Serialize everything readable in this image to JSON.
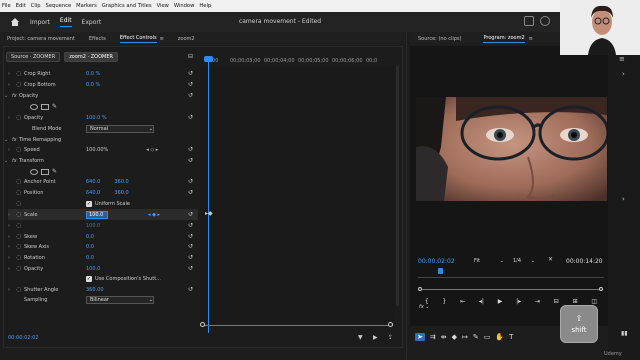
{
  "menu": [
    "File",
    "Edit",
    "Clip",
    "Sequence",
    "Markers",
    "Graphics and Titles",
    "View",
    "Window",
    "Help"
  ],
  "appbar": {
    "tabs": [
      "Import",
      "Edit",
      "Export"
    ],
    "active": "Edit",
    "title": "camera movement - Edited"
  },
  "left_tabs": {
    "items": [
      "Project: camera movement",
      "Effects",
      "Effect Controls",
      "zoom2"
    ],
    "active": "Effect Controls"
  },
  "effect_controls": {
    "source": "Source · ZOOMER",
    "sequence": "zoom2 · ZOOMER",
    "ruler": [
      "00:00",
      "00;00;03;00",
      "00;00;04;00",
      "00;00;05;00",
      "00;00;06;00",
      "00;0"
    ],
    "rows": {
      "crop_right": {
        "label": "Crop Right",
        "value": "0.0 %"
      },
      "crop_bottom": {
        "label": "Crop Bottom",
        "value": "0.0 %"
      },
      "opacity": {
        "label": "Opacity"
      },
      "opacity_value": {
        "label": "Opacity",
        "value": "100.0 %"
      },
      "blend_mode": {
        "label": "Blend Mode",
        "value": "Normal"
      },
      "time_remapping": {
        "label": "Time Remapping"
      },
      "speed": {
        "label": "Speed",
        "value": "100.00%"
      },
      "transform": {
        "label": "Transform"
      },
      "anchor_point": {
        "label": "Anchor Point",
        "x": "640.0",
        "y": "360.0"
      },
      "position": {
        "label": "Position",
        "x": "640.0",
        "y": "360.0"
      },
      "uniform_scale": {
        "label": "Uniform Scale"
      },
      "scale": {
        "label": "Scale",
        "value": "100.0"
      },
      "scale_width_value": "100.0",
      "skew": {
        "label": "Skew",
        "value": "0.0"
      },
      "skew_axis": {
        "label": "Skew Axis",
        "value": "0.0"
      },
      "rotation": {
        "label": "Rotation",
        "value": "0.0"
      },
      "opacity2": {
        "label": "Opacity",
        "value": "100.0"
      },
      "use_comp": {
        "label": "Use Composition's Shutt..."
      },
      "shutter_angle": {
        "label": "Shutter Angle",
        "value": "360.00"
      },
      "sampling": {
        "label": "Sampling",
        "value": "Bilinear"
      }
    },
    "timecode": "00:00:02:02"
  },
  "right_tabs": {
    "items": [
      "Source: (no clips)",
      "Program: zoom2"
    ],
    "active": "Program: zoom2"
  },
  "program": {
    "timecode": "00:00:02:02",
    "fit": "Fit",
    "resolution": "1/4",
    "duration": "00:00:14:20"
  },
  "shift_label": "shift",
  "watermark": "Udemy",
  "colors": {
    "accent": "#2e8cf0",
    "value_blue": "#3fa1ff"
  }
}
